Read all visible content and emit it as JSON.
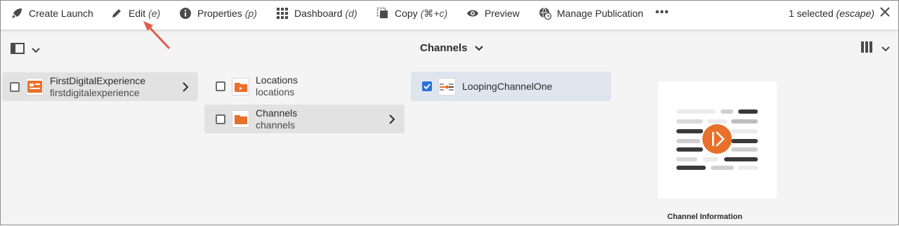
{
  "toolbar": {
    "create_launch": "Create Launch",
    "edit": "Edit",
    "edit_shortcut": "(e)",
    "properties": "Properties",
    "properties_shortcut": "(p)",
    "dashboard": "Dashboard",
    "dashboard_shortcut": "(d)",
    "copy": "Copy",
    "copy_shortcut": "(⌘+c)",
    "preview": "Preview",
    "manage_publication": "Manage Publication",
    "more": "•••",
    "selection_count": "1 selected",
    "selection_shortcut": "(escape)"
  },
  "view": {
    "column_title": "Channels"
  },
  "columns": {
    "first": [
      {
        "title": "FirstDigitalExperience",
        "subtitle": "firstdigitalexperience"
      }
    ],
    "second": [
      {
        "title": "Locations",
        "subtitle": "locations"
      },
      {
        "title": "Channels",
        "subtitle": "channels"
      }
    ],
    "third": [
      {
        "title": "LoopingChannelOne"
      }
    ]
  },
  "preview": {
    "caption": "Channel Information"
  },
  "colors": {
    "accent": "#2c73d9",
    "orange": "#e8702a",
    "annotation_arrow": "#e15b4a"
  },
  "icons": {
    "create_launch": "rocket-icon",
    "edit": "pencil-icon",
    "properties": "info-icon",
    "dashboard": "grid-icon",
    "copy": "copy-icon",
    "preview": "eye-icon",
    "manage_publication": "globe-clock-icon",
    "close": "close-icon",
    "rail": "rail-toggle-icon",
    "view": "column-view-icon"
  }
}
